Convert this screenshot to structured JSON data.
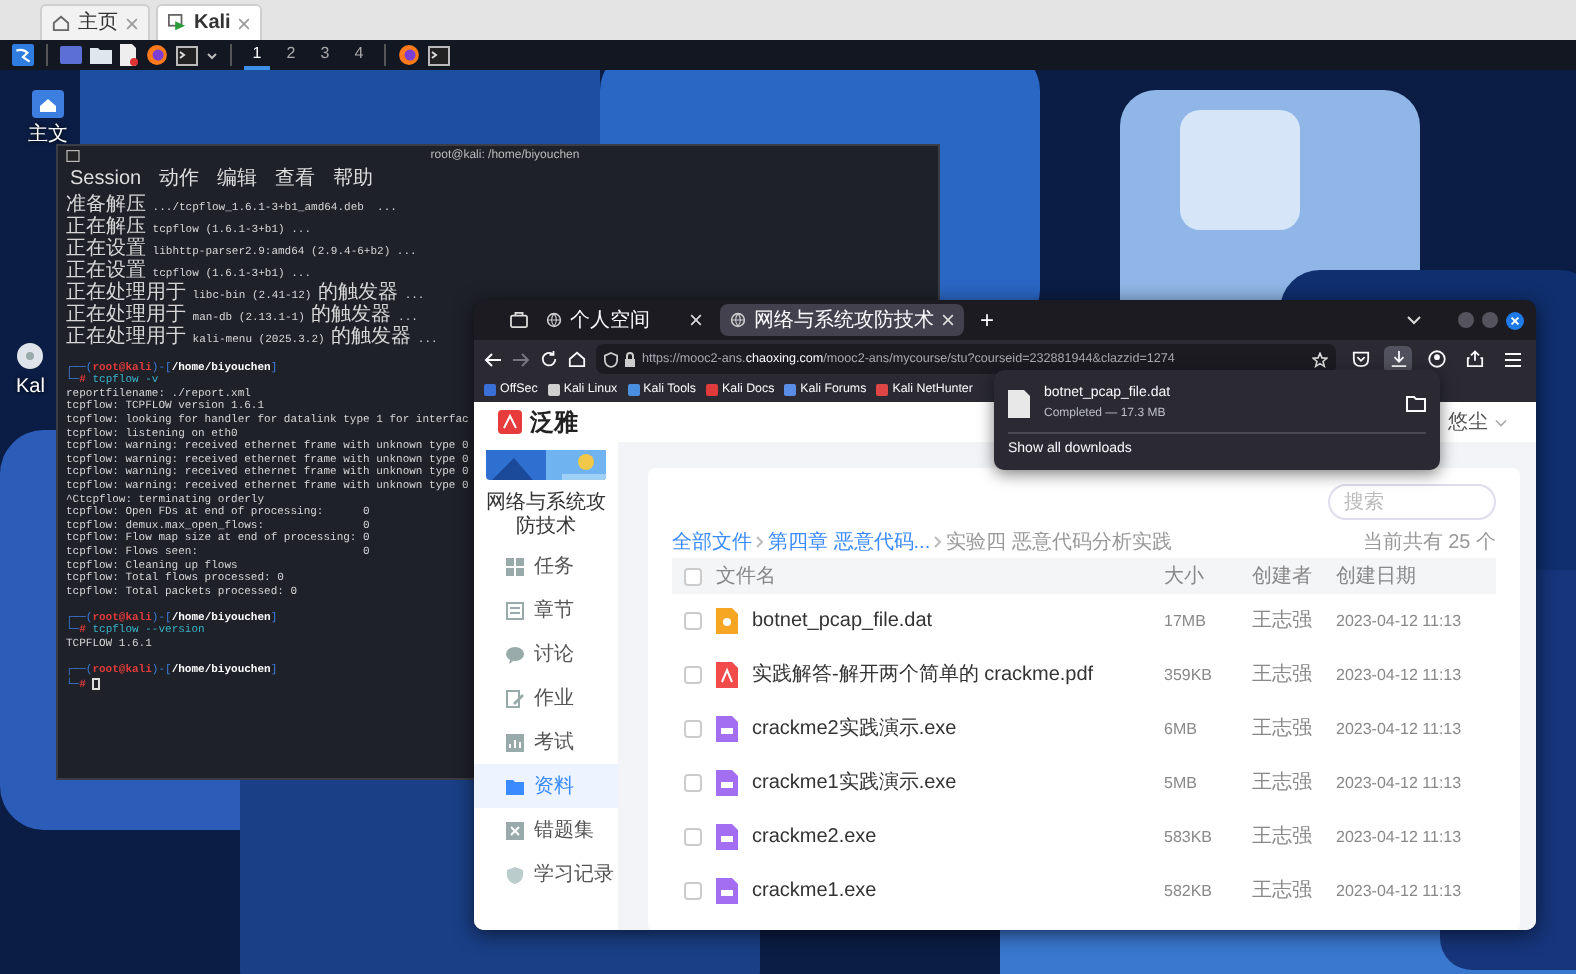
{
  "vm_tabs": [
    {
      "label": "主页",
      "kind": "home",
      "selected": false
    },
    {
      "label": "Kali",
      "kind": "vm",
      "selected": true
    }
  ],
  "panel": {
    "workspaces": [
      {
        "label": "1",
        "selected": true
      },
      {
        "label": "2",
        "selected": false
      },
      {
        "label": "3",
        "selected": false
      },
      {
        "label": "4",
        "selected": false
      }
    ]
  },
  "desktop_icons": [
    {
      "label": "主文",
      "kind": "home"
    },
    {
      "label": "Kal",
      "kind": "disc"
    }
  ],
  "terminal": {
    "title": "root@kali: /home/biyouchen",
    "menu": [
      "Session",
      "动作",
      "编辑",
      "查看",
      "帮助"
    ],
    "lines": [
      {
        "kind": "zh",
        "text": "准备解压 .../tcpflow_1.6.1-3+b1_amd64.deb  ..."
      },
      {
        "kind": "zh",
        "text": "正在解压 tcpflow (1.6.1-3+b1) ..."
      },
      {
        "kind": "zh",
        "text": "正在设置 libhttp-parser2.9:amd64 (2.9.4-6+b2) ..."
      },
      {
        "kind": "zh",
        "text": "正在设置 tcpflow (1.6.1-3+b1) ..."
      },
      {
        "kind": "zh",
        "text": "正在处理用于 libc-bin (2.41-12) 的触发器 ..."
      },
      {
        "kind": "zh",
        "text": "正在处理用于 man-db (2.13.1-1) 的触发器 ..."
      },
      {
        "kind": "zh",
        "text": "正在处理用于 kali-menu (2025.3.2) 的触发器 ..."
      },
      {
        "kind": "blank"
      },
      {
        "kind": "prompt",
        "parts": [
          "┌──(",
          "root@kali",
          ")-[",
          "/home/biyouchen",
          "]"
        ]
      },
      {
        "kind": "command",
        "parts": [
          "└─",
          "#",
          " tcpflow -v"
        ]
      },
      {
        "kind": "out",
        "text": "reportfilename: ./report.xml"
      },
      {
        "kind": "out",
        "text": "tcpflow: TCPFLOW version 1.6.1"
      },
      {
        "kind": "out",
        "text": "tcpflow: looking for handler for datalink type 1 for interfac"
      },
      {
        "kind": "out",
        "text": "tcpflow: listening on eth0"
      },
      {
        "kind": "out",
        "text": "tcpflow: warning: received ethernet frame with unknown type 0"
      },
      {
        "kind": "out",
        "text": "tcpflow: warning: received ethernet frame with unknown type 0"
      },
      {
        "kind": "out",
        "text": "tcpflow: warning: received ethernet frame with unknown type 0"
      },
      {
        "kind": "out",
        "text": "tcpflow: warning: received ethernet frame with unknown type 0"
      },
      {
        "kind": "out",
        "text": "^Ctcpflow: terminating orderly"
      },
      {
        "kind": "out",
        "text": "tcpflow: Open FDs at end of processing:      0"
      },
      {
        "kind": "out",
        "text": "tcpflow: demux.max_open_flows:               0"
      },
      {
        "kind": "out",
        "text": "tcpflow: Flow map size at end of processing: 0"
      },
      {
        "kind": "out",
        "text": "tcpflow: Flows seen:                         0"
      },
      {
        "kind": "out",
        "text": "tcpflow: Cleaning up flows"
      },
      {
        "kind": "out",
        "text": "tcpflow: Total flows processed: 0"
      },
      {
        "kind": "out",
        "text": "tcpflow: Total packets processed: 0"
      },
      {
        "kind": "blank"
      },
      {
        "kind": "prompt",
        "parts": [
          "┌──(",
          "root@kali",
          ")-[",
          "/home/biyouchen",
          "]"
        ]
      },
      {
        "kind": "command",
        "parts": [
          "└─",
          "#",
          " tcpflow --version"
        ]
      },
      {
        "kind": "out",
        "text": "TCPFLOW 1.6.1"
      },
      {
        "kind": "blank"
      },
      {
        "kind": "prompt",
        "parts": [
          "┌──(",
          "root@kali",
          ")-[",
          "/home/biyouchen",
          "]"
        ]
      },
      {
        "kind": "command",
        "parts": [
          "└─",
          "#"
        ],
        "cursor": true
      }
    ]
  },
  "browser": {
    "tabs": [
      {
        "label": "个人空间",
        "selected": false
      },
      {
        "label": "网络与系统攻防技术",
        "selected": true
      }
    ],
    "new_tab": "+",
    "url": "https://mooc2-ans.**chaoxing.com**/mooc2-ans/mycourse/stu?courseid=232881944&clazzid=1274",
    "bookmarks": [
      {
        "label": "OffSec",
        "color": "#3b6fd8"
      },
      {
        "label": "Kali Linux",
        "color": "#d0d0d0"
      },
      {
        "label": "Kali Tools",
        "color": "#4a8fe0"
      },
      {
        "label": "Kali Docs",
        "color": "#e23b3b"
      },
      {
        "label": "Kali Forums",
        "color": "#5a8de8"
      },
      {
        "label": "Kali NetHunter",
        "color": "#e04545"
      }
    ],
    "downloads": {
      "file": "botnet_pcap_file.dat",
      "status": "Completed — 17.3 MB",
      "link": "Show all downloads"
    },
    "site": {
      "logo": "泛雅",
      "user": "悠尘",
      "course_title": "网络与系统攻防技术",
      "nav": [
        {
          "label": "任务",
          "selected": false
        },
        {
          "label": "章节",
          "selected": false
        },
        {
          "label": "讨论",
          "selected": false
        },
        {
          "label": "作业",
          "selected": false
        },
        {
          "label": "考试",
          "selected": false
        },
        {
          "label": "资料",
          "selected": true
        },
        {
          "label": "错题集",
          "selected": false
        },
        {
          "label": "学习记录",
          "selected": false
        }
      ],
      "search": {
        "placeholder": "搜索"
      },
      "breadcrumb": [
        "全部文件",
        "第四章 恶意代码...",
        "实验四 恶意代码分析实践"
      ],
      "count": "当前共有 25 个",
      "columns": [
        "文件名",
        "大小",
        "创建者",
        "创建日期"
      ],
      "header_checked": false,
      "rows": [
        {
          "kind": "unknown",
          "name": "botnet_pcap_file.dat",
          "size": "17MB",
          "creator": "王志强",
          "date": "2023-04-12 11:13",
          "checked": false
        },
        {
          "kind": "pdf",
          "name": "实践解答-解开两个简单的 crackme.pdf",
          "size": "359KB",
          "creator": "王志强",
          "date": "2023-04-12 11:13",
          "checked": false
        },
        {
          "kind": "exe",
          "name": "crackme2实践演示.exe",
          "size": "6MB",
          "creator": "王志强",
          "date": "2023-04-12 11:13",
          "checked": false
        },
        {
          "kind": "exe",
          "name": "crackme1实践演示.exe",
          "size": "5MB",
          "creator": "王志强",
          "date": "2023-04-12 11:13",
          "checked": false
        },
        {
          "kind": "exe",
          "name": "crackme2.exe",
          "size": "583KB",
          "creator": "王志强",
          "date": "2023-04-12 11:13",
          "checked": false
        },
        {
          "kind": "exe",
          "name": "crackme1.exe",
          "size": "582KB",
          "creator": "王志强",
          "date": "2023-04-12 11:13",
          "checked": false
        }
      ]
    }
  }
}
